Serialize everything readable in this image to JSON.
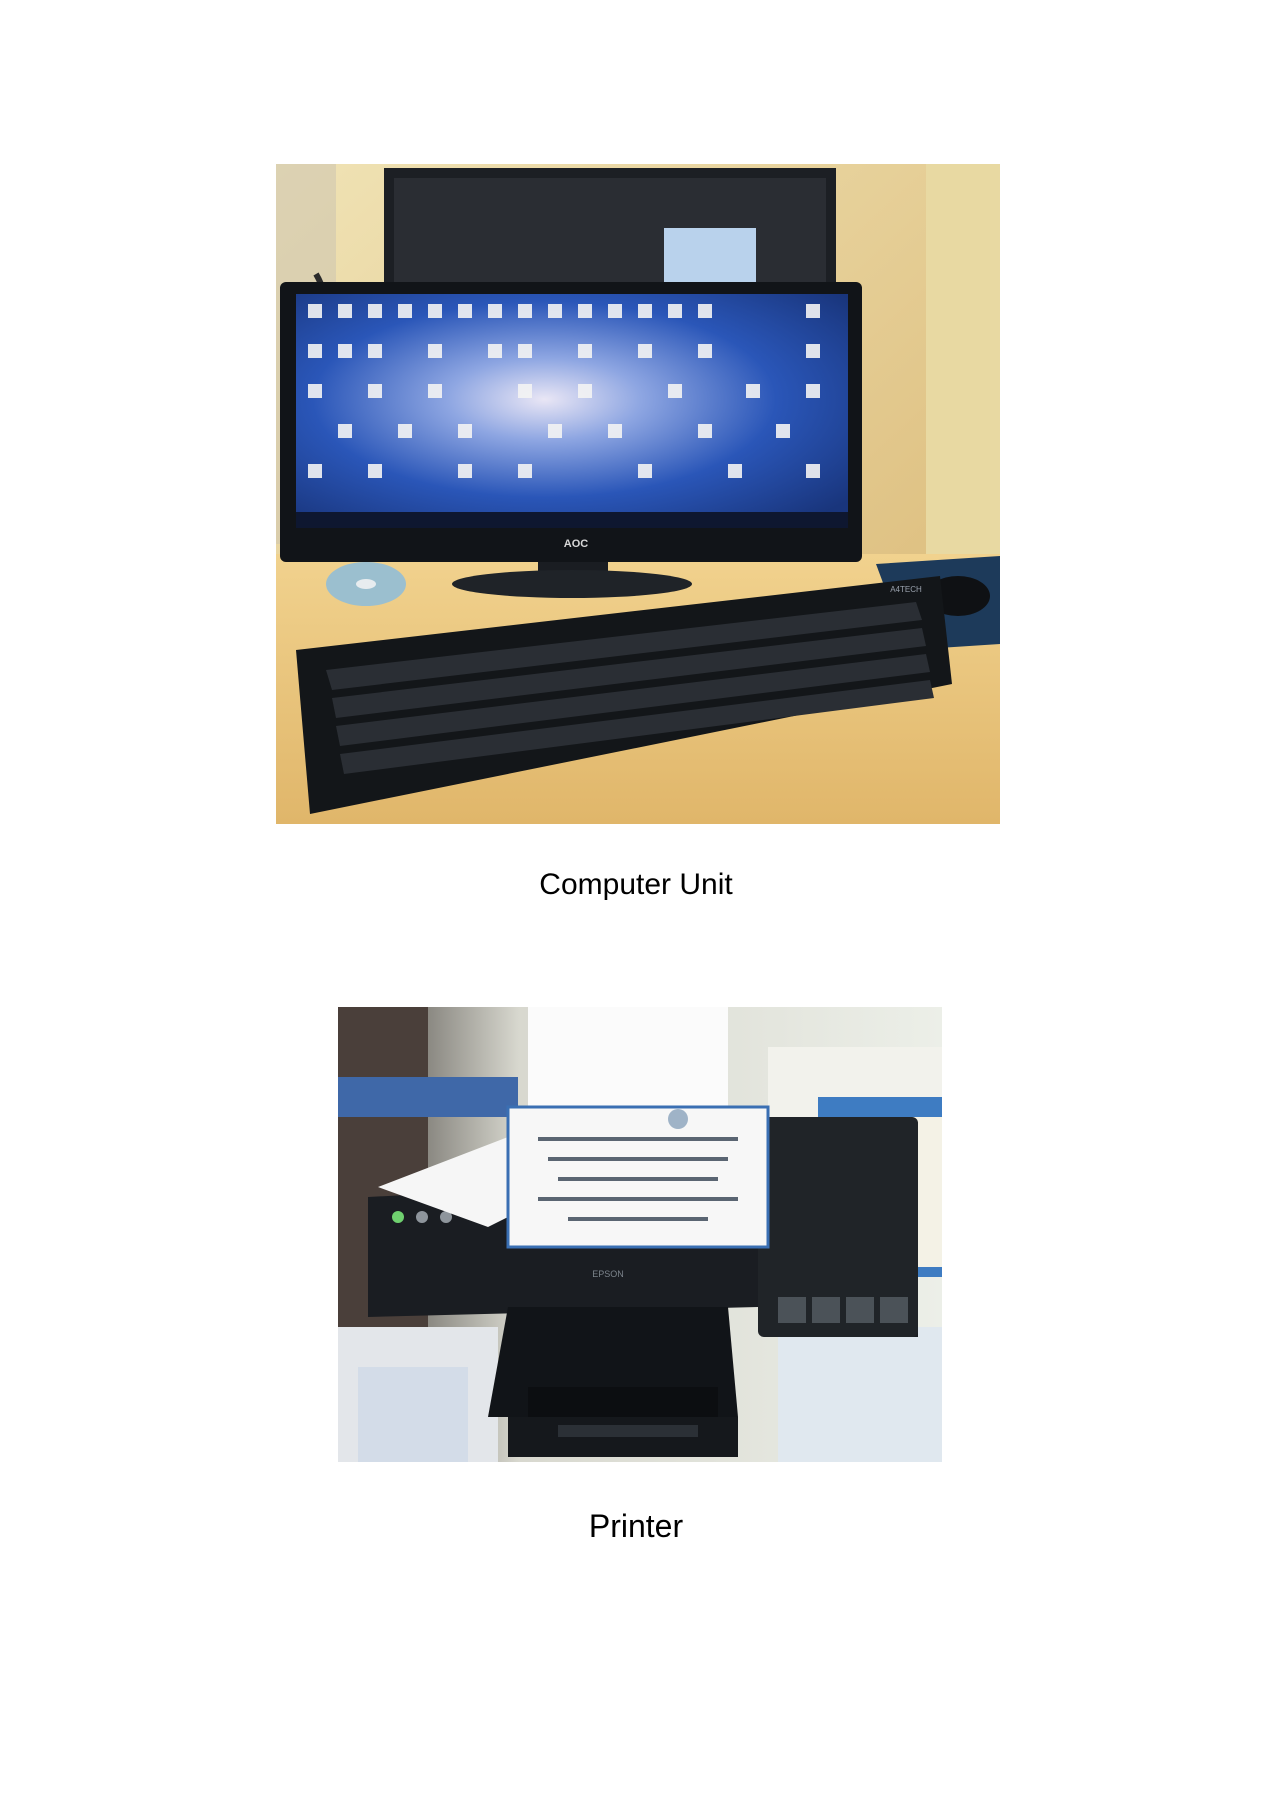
{
  "document": {
    "figures": [
      {
        "caption": "Computer Unit",
        "photo_subject": "desktop-computer-monitor-keyboard-mouse",
        "monitor_brand": "AOC",
        "keyboard_brand": "A4TECH"
      },
      {
        "caption": "Printer",
        "photo_subject": "inkjet-printer-with-certificate",
        "printer_brand": "EPSON"
      }
    ]
  },
  "colors": {
    "page_background": "#ffffff",
    "desk": "#e7c27a",
    "wall": "#f3e4ad",
    "screen_blue": "#2a56b8",
    "device_black": "#151a20"
  }
}
